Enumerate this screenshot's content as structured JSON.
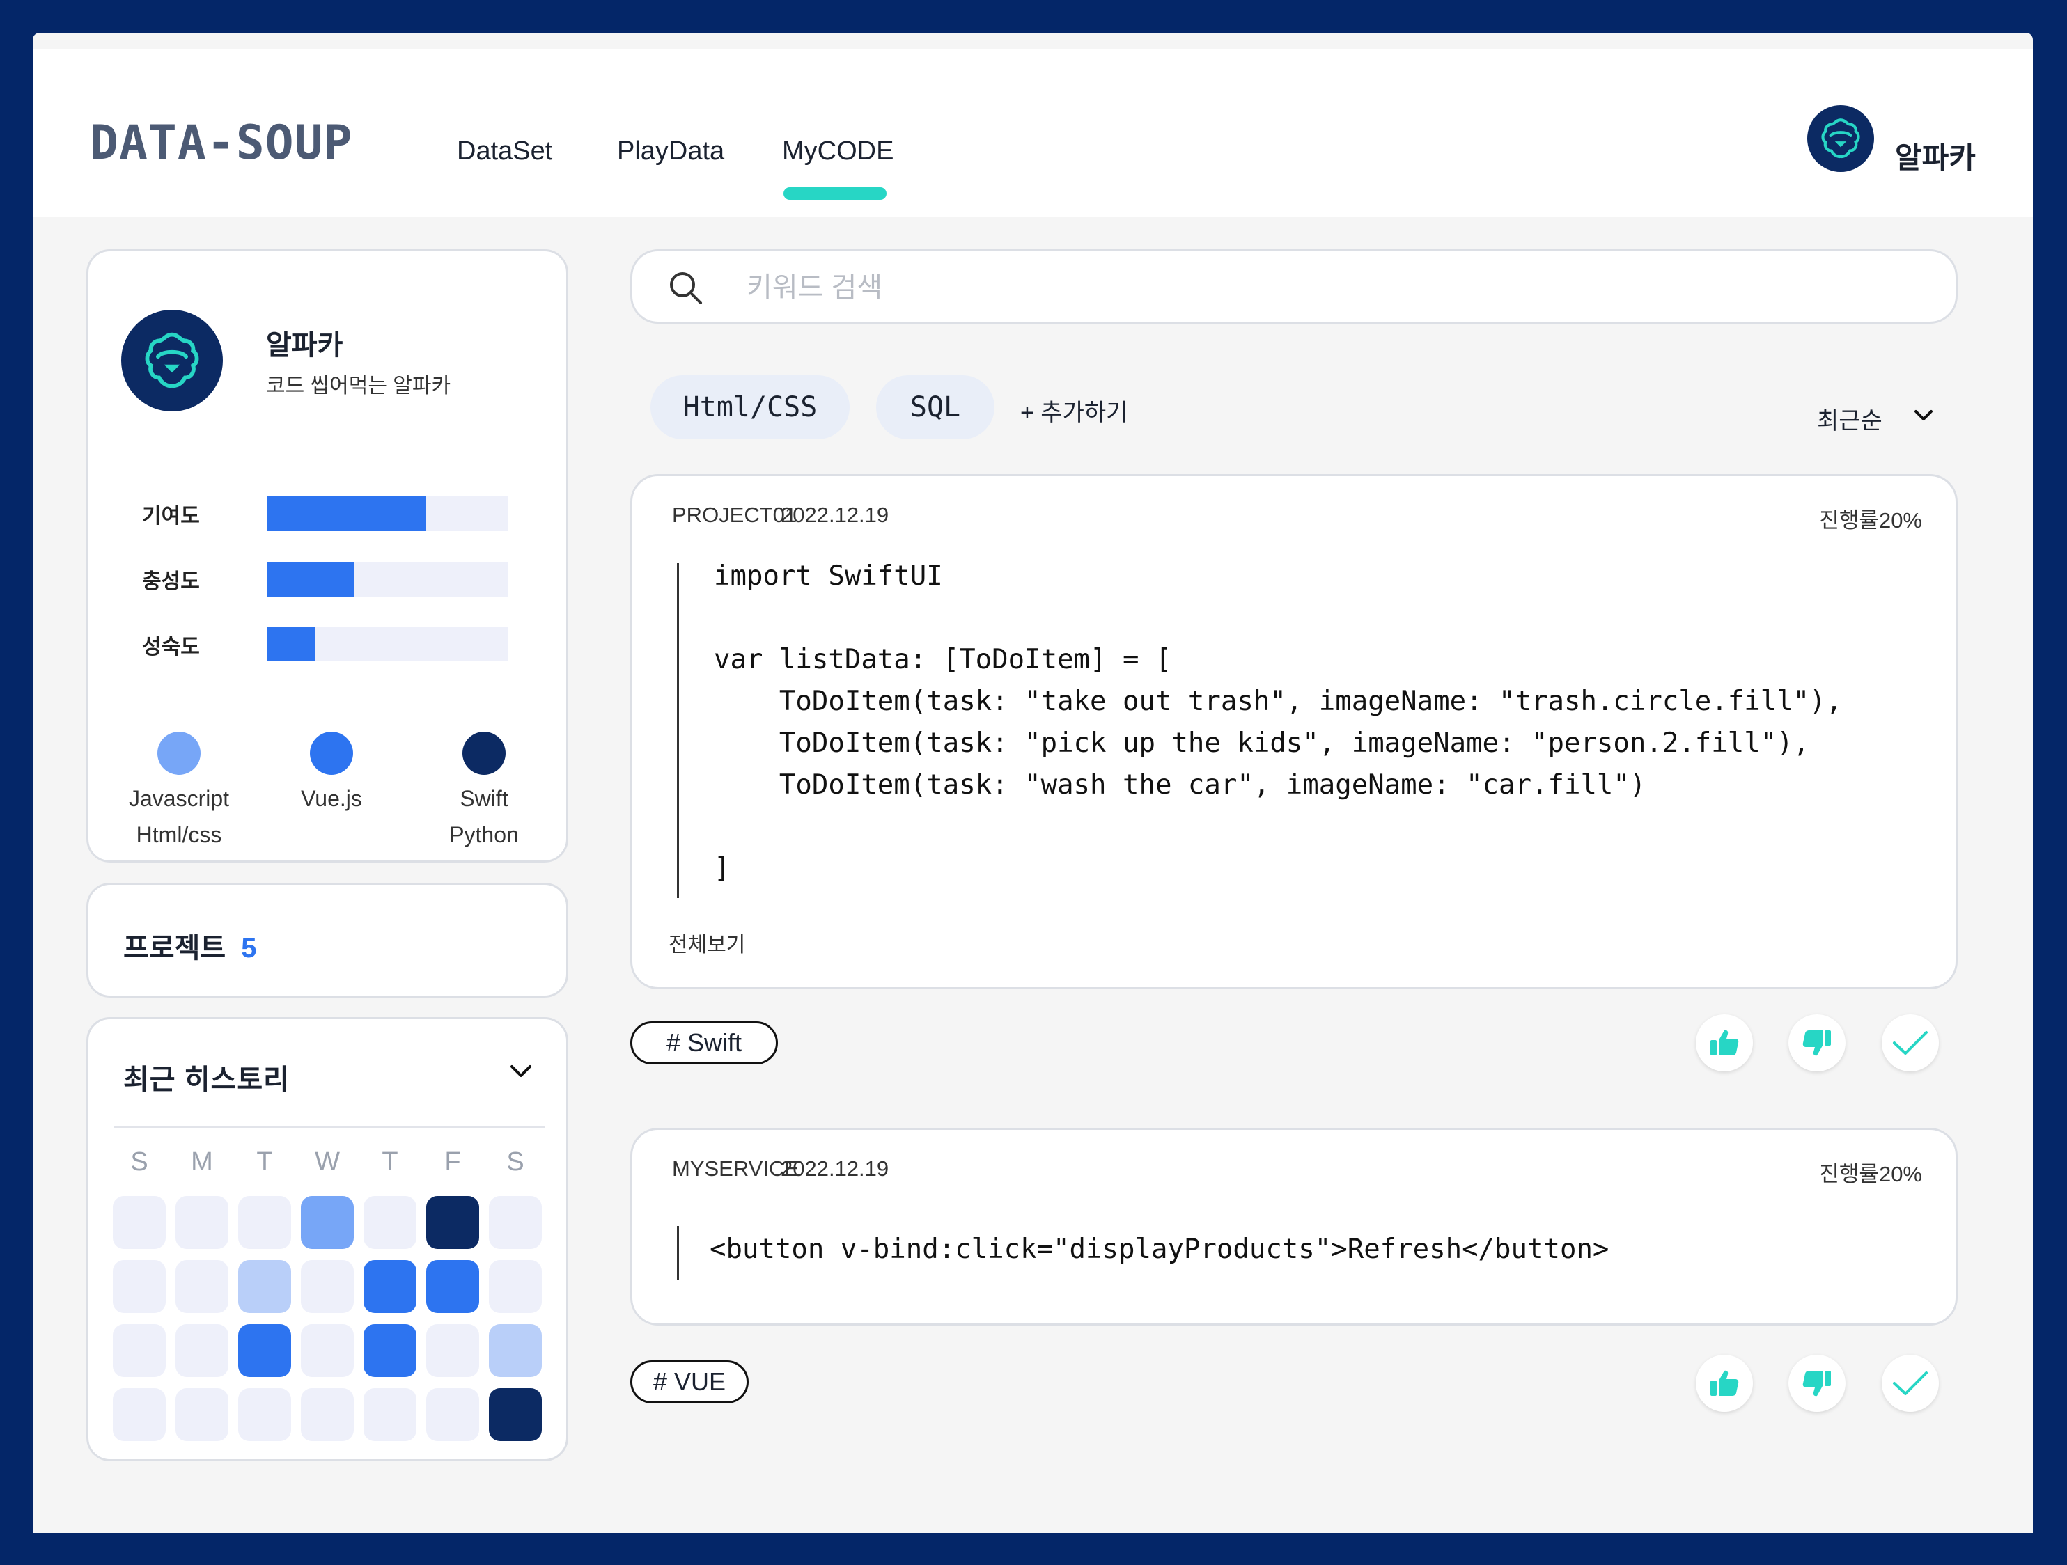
{
  "header": {
    "logo": "DATA-SOUP",
    "nav": [
      "DataSet",
      "PlayData",
      "MyCODE"
    ],
    "active_nav": "MyCODE",
    "user_name": "알파카"
  },
  "profile": {
    "name": "알파카",
    "description": "코드 씹어먹는 알파카",
    "stats": [
      {
        "label": "기여도",
        "value": 0.66
      },
      {
        "label": "충성도",
        "value": 0.36
      },
      {
        "label": "성숙도",
        "value": 0.2
      }
    ],
    "skills": [
      {
        "line1": "Javascript",
        "line2": "Html/css",
        "color": "#77a6f7"
      },
      {
        "line1": "Vue.js",
        "line2": "",
        "color": "#2d74f0"
      },
      {
        "line1": "Swift",
        "line2": "Python",
        "color": "#0c2a63"
      }
    ]
  },
  "projects": {
    "label": "프로젝트",
    "count": "5"
  },
  "history": {
    "title": "최근 히스토리",
    "days": [
      "S",
      "M",
      "T",
      "W",
      "T",
      "F",
      "S"
    ],
    "levels": [
      [
        0,
        0,
        0,
        2,
        0,
        4,
        0
      ],
      [
        0,
        0,
        1,
        0,
        3,
        3,
        0
      ],
      [
        0,
        0,
        3,
        0,
        3,
        0,
        1
      ],
      [
        0,
        0,
        0,
        0,
        0,
        0,
        4
      ]
    ],
    "level_colors": [
      "#eef0fa",
      "#b9cff9",
      "#77a6f7",
      "#2d74f0",
      "#0c2a63"
    ]
  },
  "search": {
    "placeholder": "키워드 검색"
  },
  "filters": {
    "tags": [
      "Html/CSS",
      "SQL"
    ],
    "add_label": "+ 추가하기",
    "sort_label": "최근순"
  },
  "code_cards": [
    {
      "title": "PROJECT01",
      "date": "2022.12.19",
      "progress": "진행률20%",
      "code": "import SwiftUI\n\nvar listData: [ToDoItem] = [\n    ToDoItem(task: \"take out trash\", imageName: \"trash.circle.fill\"),\n    ToDoItem(task: \"pick up the kids\", imageName: \"person.2.fill\"),\n    ToDoItem(task: \"wash the car\", imageName: \"car.fill\")\n\n]",
      "view_all": "전체보기",
      "hashtag": "# Swift"
    },
    {
      "title": "MYSERVICE",
      "date": "2022.12.19",
      "progress": "진행률20%",
      "code": "<button v-bind:click=\"displayProducts\">Refresh</button>",
      "hashtag": "# VUE"
    }
  ],
  "colors": {
    "frame": "#042668",
    "accent_teal": "#27d6c5",
    "primary_blue": "#2d74f0",
    "navy": "#0c2a63"
  }
}
